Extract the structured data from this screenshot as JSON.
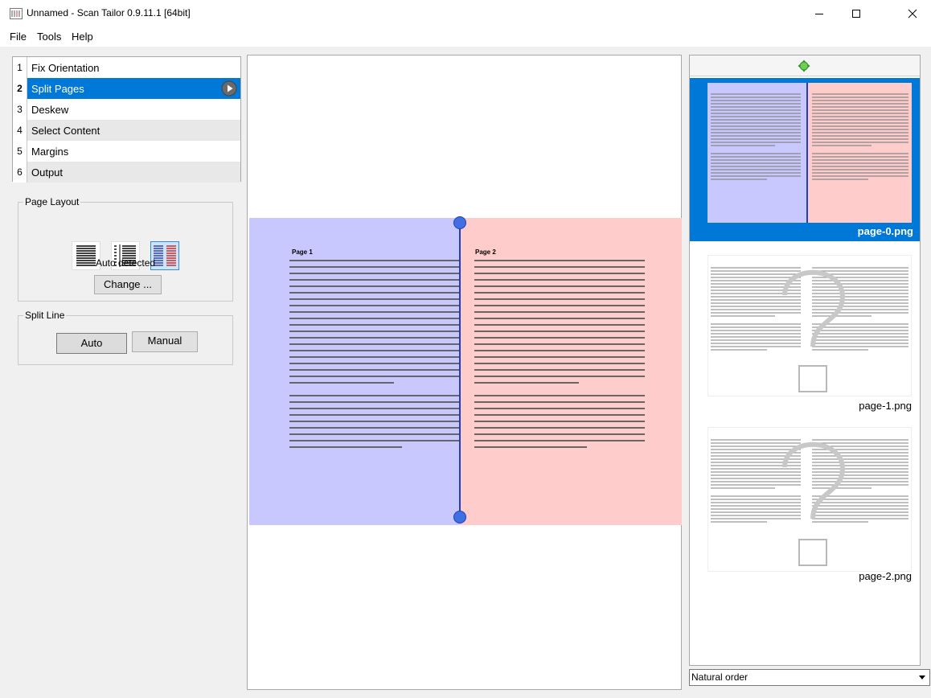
{
  "window": {
    "title": "Unnamed - Scan Tailor 0.9.11.1 [64bit]"
  },
  "menu": [
    "File",
    "Tools",
    "Help"
  ],
  "stages": [
    {
      "num": "1",
      "label": "Fix Orientation"
    },
    {
      "num": "2",
      "label": "Split Pages"
    },
    {
      "num": "3",
      "label": "Deskew"
    },
    {
      "num": "4",
      "label": "Select Content"
    },
    {
      "num": "5",
      "label": "Margins"
    },
    {
      "num": "6",
      "label": "Output"
    }
  ],
  "page_layout": {
    "title": "Page Layout",
    "status": "Auto detected",
    "change_label": "Change ..."
  },
  "split_line": {
    "title": "Split Line",
    "auto_label": "Auto",
    "manual_label": "Manual"
  },
  "preview": {
    "left_heading": "Page 1",
    "right_heading": "Page 2",
    "left_color": "#c8c8ff",
    "right_color": "#ffcccc",
    "split_color": "#1f3fbf"
  },
  "thumbnails": [
    {
      "caption": "page-0.png"
    },
    {
      "caption": "page-1.png"
    },
    {
      "caption": "page-2.png"
    }
  ],
  "sort_order": "Natural order",
  "colors": {
    "accent": "#0078d7"
  }
}
